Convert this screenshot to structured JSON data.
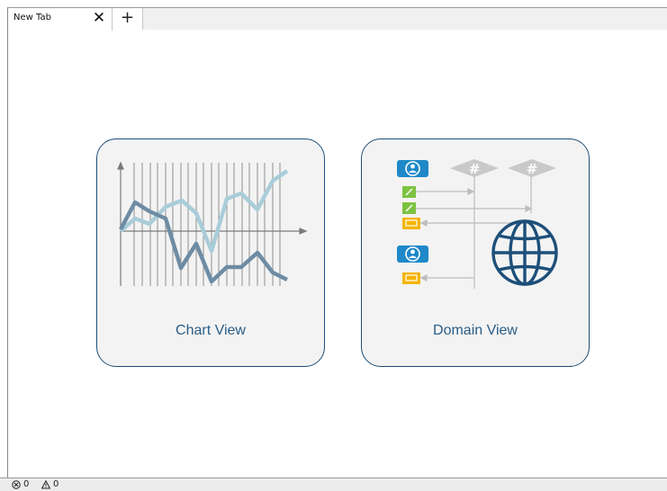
{
  "tabs": [
    {
      "title": "New Tab"
    }
  ],
  "tab_controls": {
    "close_glyph": "✕",
    "new_glyph": "+"
  },
  "cards": {
    "chart_view": {
      "label": "Chart View",
      "icon": "line-chart-icon"
    },
    "domain_view": {
      "label": "Domain View",
      "icon": "domain-diagram-icon"
    }
  },
  "status": {
    "errors": {
      "icon": "error-circle-icon",
      "count": "0"
    },
    "warnings": {
      "icon": "warning-triangle-icon",
      "count": "0"
    }
  },
  "colors": {
    "card_border": "#1d4f7a",
    "card_bg": "#f3f3f3",
    "label": "#2a5d86",
    "chart_light": "#a9cdd9",
    "chart_dark": "#6e8ca4",
    "user_blue": "#1e88c8",
    "edit_green": "#7dc242",
    "log_yellow": "#f4b400",
    "hash_gray": "#c9c9c9",
    "globe": "#1d4f7a"
  }
}
